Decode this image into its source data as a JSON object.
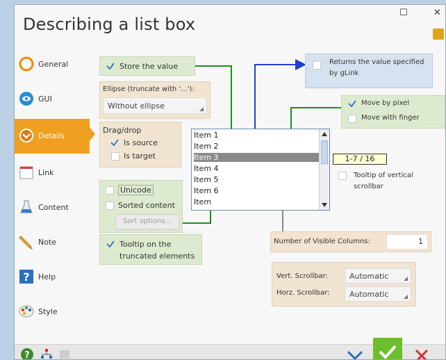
{
  "window": {
    "title": "Describing a list box",
    "maximize_glyph": "☐",
    "close_glyph": "✕"
  },
  "sidebar": {
    "items": [
      {
        "label": "General",
        "icon": "general-icon"
      },
      {
        "label": "GUI",
        "icon": "gui-icon"
      },
      {
        "label": "Details",
        "icon": "details-icon",
        "active": true
      },
      {
        "label": "Link",
        "icon": "link-icon"
      },
      {
        "label": "Content",
        "icon": "content-icon"
      },
      {
        "label": "Note",
        "icon": "note-icon"
      },
      {
        "label": "Help",
        "icon": "help-icon"
      },
      {
        "label": "Style",
        "icon": "style-icon"
      }
    ]
  },
  "details": {
    "store_value": {
      "label": "Store the value",
      "checked": true
    },
    "ellipse": {
      "label": "Ellipse (truncate with '...'):",
      "value": "Without ellipse"
    },
    "dragdrop": {
      "label": "Drag/drop",
      "is_source": {
        "label": "Is source",
        "checked": true
      },
      "is_target": {
        "label": "Is target",
        "checked": false
      }
    },
    "unicode": {
      "label": "Unicode",
      "checked": false
    },
    "sorted": {
      "label": "Sorted content",
      "checked": false
    },
    "sort_options": "Sort options...",
    "tooltip_truncated": {
      "line1": "Tooltip on the",
      "line2": "truncated elements",
      "checked": true
    },
    "glink": {
      "line1": "Returns the value specified",
      "line2": "by gLink",
      "checked": false
    },
    "move_pixel": {
      "label": "Move by pixel",
      "checked": true
    },
    "move_finger": {
      "label": "Move with finger",
      "checked": false
    },
    "list": {
      "items": [
        "Item 1",
        "Item 2",
        "Item 3",
        "Item 4",
        "Item 5",
        "Item 6",
        "Item"
      ],
      "selected_index": 2
    },
    "counter": "1-7 / 16",
    "tooltip_scrollbar": {
      "line1": "Tooltip of vertical",
      "line2": "scrollbar",
      "checked": false
    },
    "visible_columns": {
      "label": "Number of Visible Columns:",
      "value": "1"
    },
    "vert_scrollbar": {
      "label": "Vert. Scrollbar:",
      "value": "Automatic"
    },
    "horz_scrollbar": {
      "label": "Horz. Scrollbar:",
      "value": "Automatic"
    }
  },
  "colors": {
    "accent": "#f0a020",
    "green_panel": "#ddeacf",
    "tan_panel": "#f1e5d2",
    "blue_panel": "#d6e2ef",
    "arrow_green": "#1a8f1a",
    "arrow_blue": "#1f3fd6",
    "ok_green": "#6bbf2a"
  }
}
